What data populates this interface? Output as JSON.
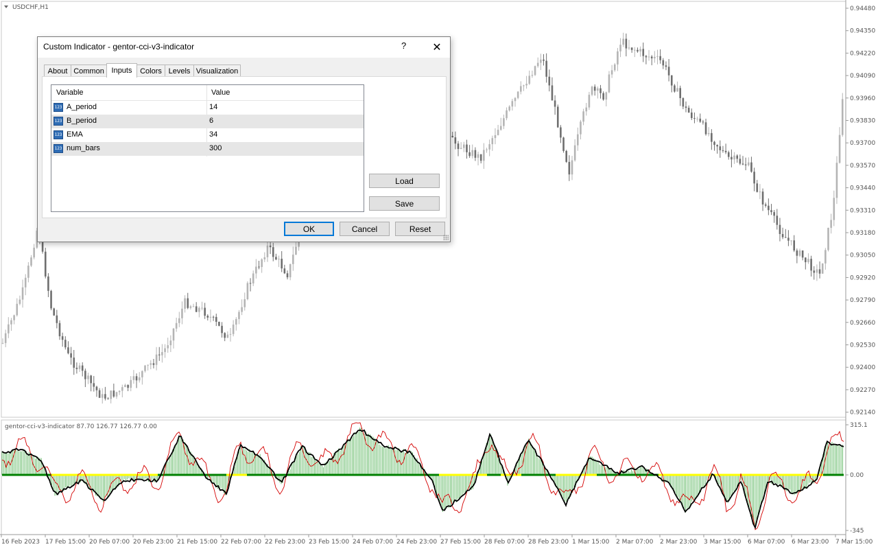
{
  "chart": {
    "symbol_label": "USDCHF,H1",
    "price_axis": [
      "0.94480",
      "0.94350",
      "0.94220",
      "0.94090",
      "0.93960",
      "0.93830",
      "0.93700",
      "0.93570",
      "0.93440",
      "0.93310",
      "0.93180",
      "0.93050",
      "0.92920",
      "0.92790",
      "0.92660",
      "0.92530",
      "0.92400",
      "0.92270",
      "0.92140"
    ],
    "time_axis": [
      "16 Feb 2023",
      "17 Feb 15:00",
      "20 Feb 07:00",
      "20 Feb 23:00",
      "21 Feb 15:00",
      "22 Feb 07:00",
      "22 Feb 23:00",
      "23 Feb 15:00",
      "24 Feb 07:00",
      "24 Feb 23:00",
      "27 Feb 15:00",
      "28 Feb 07:00",
      "28 Feb 23:00",
      "1 Mar 15:00",
      "2 Mar 07:00",
      "2 Mar 23:00",
      "3 Mar 15:00",
      "6 Mar 07:00",
      "6 Mar 23:00",
      "7 Mar 15:00"
    ],
    "indicator_label": "gentor-cci-v3-indicator 87.70 126.77 126.77 0.00",
    "indicator_axis": [
      "315.1",
      "0.00",
      "-345"
    ],
    "colors": {
      "bull": "#b4b4b4",
      "bear": "#6e6e6e",
      "hist": "#4caf50",
      "hist_zero": "#ffff00",
      "line_main": "#000000",
      "line_sig": "#d40000",
      "zero_line": "#008000"
    }
  },
  "dialog": {
    "title": "Custom Indicator - gentor-cci-v3-indicator",
    "help": "?",
    "close_icon": "close-icon",
    "tabs": [
      "About",
      "Common",
      "Inputs",
      "Colors",
      "Levels",
      "Visualization"
    ],
    "active_tab": "Inputs",
    "table": {
      "headers": [
        "Variable",
        "Value"
      ],
      "rows": [
        {
          "icon": "123",
          "variable": "A_period",
          "value": "14"
        },
        {
          "icon": "123",
          "variable": "B_period",
          "value": "6"
        },
        {
          "icon": "123",
          "variable": "EMA",
          "value": "34"
        },
        {
          "icon": "123",
          "variable": "num_bars",
          "value": "300"
        }
      ]
    },
    "buttons": {
      "load": "Load",
      "save": "Save",
      "ok": "OK",
      "cancel": "Cancel",
      "reset": "Reset"
    }
  }
}
